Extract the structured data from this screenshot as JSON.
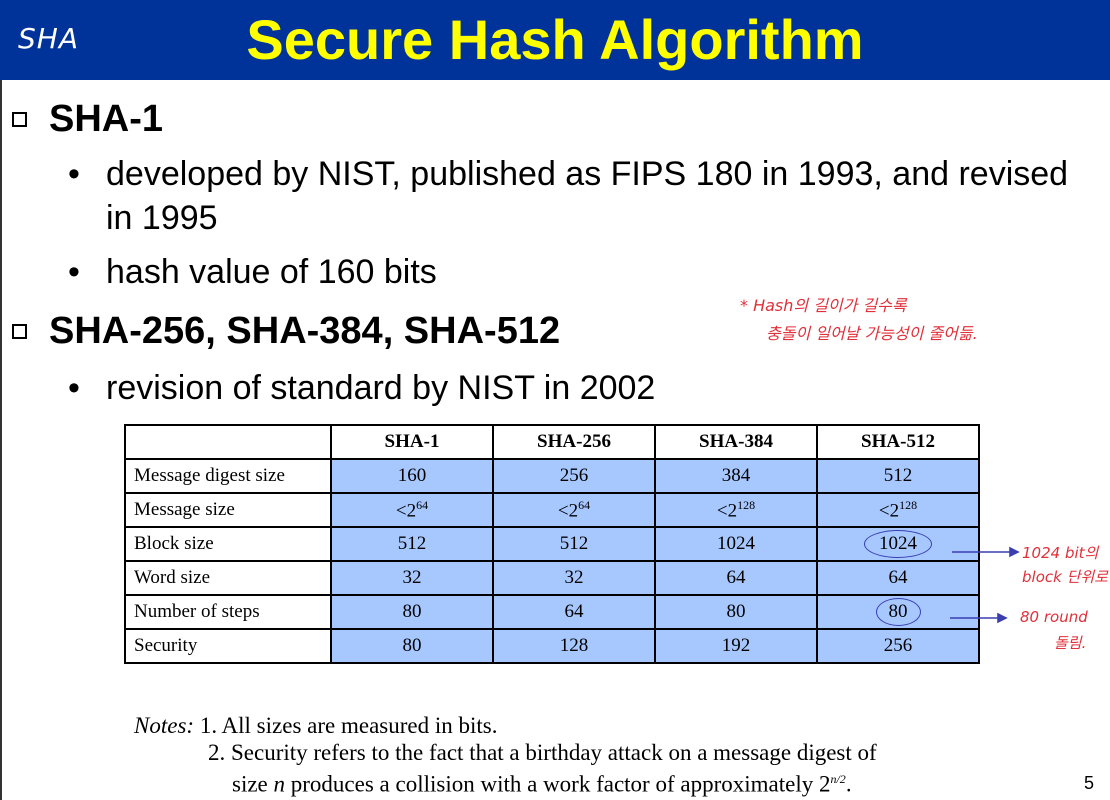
{
  "slide": {
    "title": "Secure Hash Algorithm",
    "handwritten_tag": "SHA",
    "page_number": "5"
  },
  "sections": [
    {
      "heading": "SHA-1",
      "bullets": [
        "developed by NIST, published as FIPS 180 in 1993, and revised in 1995",
        "hash value of 160 bits"
      ]
    },
    {
      "heading": "SHA-256, SHA-384, SHA-512",
      "bullets": [
        "revision of standard by NIST in 2002"
      ]
    }
  ],
  "annotations": {
    "top_line1": "* Hash의 길이가 길수록",
    "top_line2": "충돌이 일어날 가능성이 줄어듦.",
    "block_line1": "1024 bit의",
    "block_line2": "block 단위로",
    "steps_line1": "80 round",
    "steps_line2": "돌림."
  },
  "table": {
    "headers": [
      "",
      "SHA-1",
      "SHA-256",
      "SHA-384",
      "SHA-512"
    ],
    "rows": [
      {
        "label": "Message digest size",
        "cells": [
          "160",
          "256",
          "384",
          "512"
        ]
      },
      {
        "label": "Message size",
        "cells": [
          [
            "<2",
            "64"
          ],
          [
            "<2",
            "64"
          ],
          [
            "<2",
            "128"
          ],
          [
            "<2",
            "128"
          ]
        ]
      },
      {
        "label": "Block size",
        "cells": [
          "512",
          "512",
          "1024",
          "1024"
        ]
      },
      {
        "label": "Word size",
        "cells": [
          "32",
          "32",
          "64",
          "64"
        ]
      },
      {
        "label": "Number of steps",
        "cells": [
          "80",
          "64",
          "80",
          "80"
        ]
      },
      {
        "label": "Security",
        "cells": [
          "80",
          "128",
          "192",
          "256"
        ]
      }
    ]
  },
  "notes": {
    "label": "Notes:",
    "n1": "1. All sizes are measured in bits.",
    "n2a": "2. Security refers to the fact that a birthday attack on a message digest of",
    "n2b_pre": "size ",
    "n2b_var": "n",
    "n2b_mid": " produces a collision with a work factor of approximately 2",
    "n2b_exp": "n/2",
    "n2b_end": "."
  },
  "colors": {
    "title_bg": "#003399",
    "title_fg": "#ffff00",
    "cell_bg": "#a7c7ff",
    "annot": "#e0303a"
  }
}
